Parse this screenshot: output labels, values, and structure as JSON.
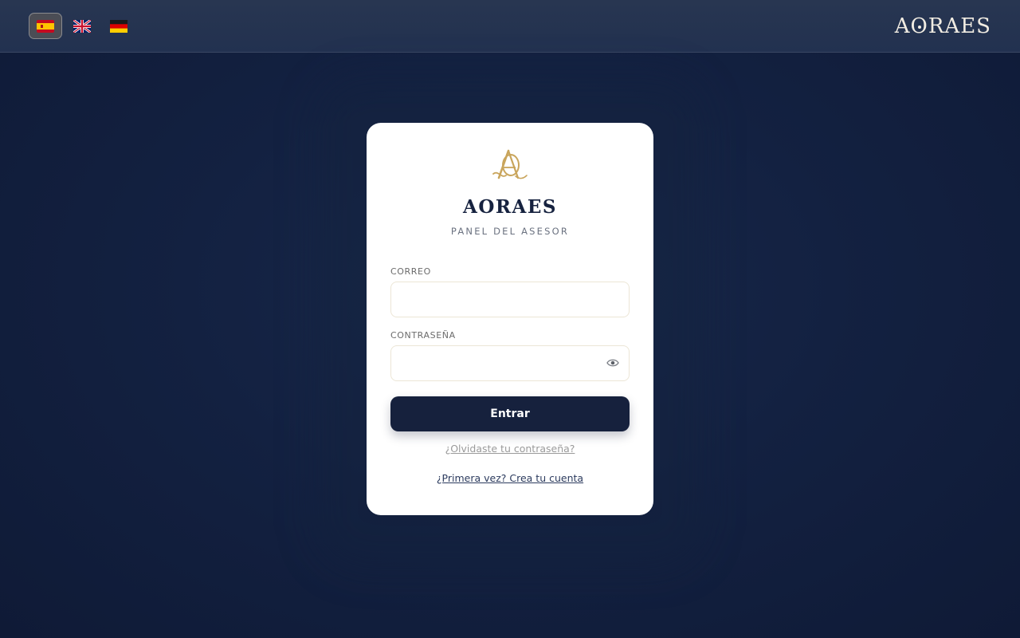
{
  "header": {
    "languages": [
      {
        "code": "es",
        "icon": "spain-flag-icon",
        "active": true
      },
      {
        "code": "en",
        "icon": "uk-flag-icon",
        "active": false
      },
      {
        "code": "de",
        "icon": "germany-flag-icon",
        "active": false
      }
    ],
    "brand_pre": "A",
    "brand_o": "O",
    "brand_post": "RAES"
  },
  "card": {
    "logo_icon": "monogram-ao-icon",
    "title": "AORAES",
    "subtitle": "PANEL DEL ASESOR",
    "email": {
      "label": "CORREO",
      "value": "",
      "placeholder": ""
    },
    "password": {
      "label": "CONTRASEÑA",
      "value": "",
      "placeholder": "",
      "toggle_icon": "eye-icon"
    },
    "submit_label": "Entrar",
    "forgot_link": "¿Olvidaste tu contraseña?",
    "signup_link": "¿Primera vez? Crea tu cuenta"
  },
  "colors": {
    "background": "#132141",
    "topbar": "#263450",
    "primary": "#16213d",
    "accent_gold": "#c9a55c",
    "card": "#ffffff"
  }
}
